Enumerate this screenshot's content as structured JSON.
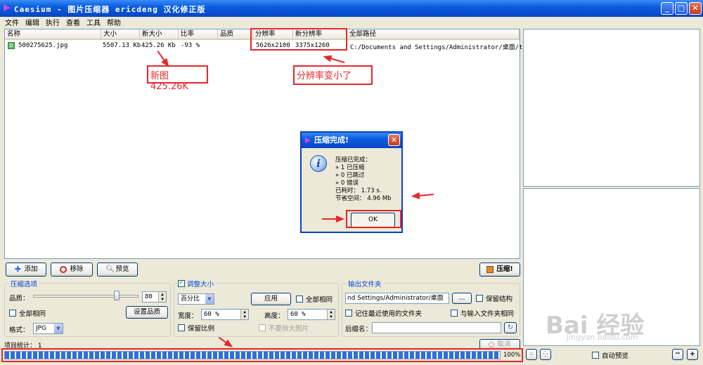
{
  "window": {
    "title": "Caesium - 图片压缩器  ericdeng 汉化修正版",
    "minimize": "_",
    "maximize": "□",
    "close": "✕"
  },
  "menu": [
    "文件",
    "编辑",
    "执行",
    "查看",
    "工具",
    "帮助"
  ],
  "table": {
    "columns": [
      "名称",
      "大小",
      "新大小",
      "比率",
      "品质",
      "分辨率",
      "新分辨率",
      "全部路径"
    ],
    "rows": [
      {
        "name": "500275625.jpg",
        "size": "5507.13 Kb",
        "new_size": "425.26 Kb",
        "ratio": "-93 %",
        "quality": "",
        "resolution": "5626x2100",
        "new_resolution": "3375x1260",
        "path": "C:/Documents and Settings/Administrator/桌面/tp…"
      }
    ]
  },
  "annotations": {
    "new_size_note": "新图425.26K",
    "resolution_note": "分辨率变小了"
  },
  "dialog": {
    "title": "压缩完成!",
    "lines": [
      "压缩已完成：",
      "» 1 已压缩",
      "» 0 已跳过",
      "» 0 错误",
      "已耗时： 1.73 s.",
      "节省空间： 4.96 Mb"
    ],
    "ok_label": "OK"
  },
  "toolbar": {
    "add_label": "添加",
    "remove_label": "移除",
    "preview_label": "预览",
    "compress_label": "压缩!"
  },
  "compression_options": {
    "title": "压缩选项",
    "quality_label": "品质：",
    "quality_value": "80",
    "quality_level": 0.8,
    "same_for_all_label": "全部相同",
    "set_quality_label": "设置品质",
    "format_label": "格式：",
    "format_value": "JPG"
  },
  "resize": {
    "title": "调整大小",
    "mode_value": "百分比",
    "apply_label": "应用",
    "all_same_label": "全部相同",
    "width_label": "宽度：",
    "width_value": "60 %",
    "height_label": "高度：",
    "height_value": "60 %",
    "keep_ratio_label": "保留比例",
    "no_enlarge_label": "不要放大图片"
  },
  "output": {
    "title": "输出文件夹",
    "path_value": "nd Settings/Administrator/桌面",
    "browse_label": "...",
    "keep_structure_label": "保留结构",
    "remember_label": "记住最近使用的文件夹",
    "same_as_input_label": "与输入文件夹相同",
    "suffix_label": "后缀名："
  },
  "status": {
    "items_label": "项目统计： 1",
    "cancel_label": "取消",
    "progress_percent": 100,
    "progress_text": "100%",
    "auto_preview_label": "自动预览"
  },
  "watermark": {
    "brand": "Bai 经验",
    "url": "jingyan.baidu.com"
  }
}
